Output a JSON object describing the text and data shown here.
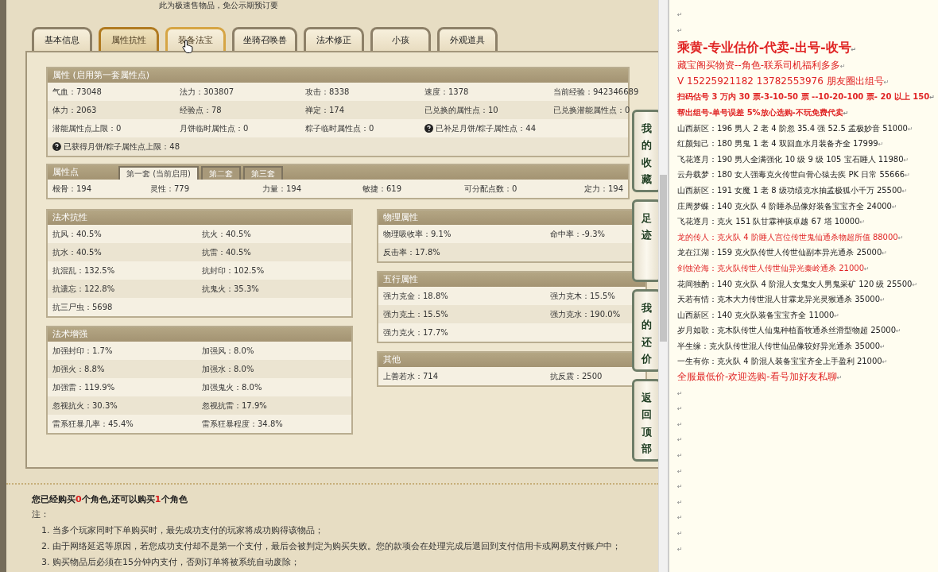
{
  "top_note": "此为极速售物品，免公示期预订要",
  "tabs": [
    {
      "label": "基本信息",
      "selected": false,
      "hovered": false
    },
    {
      "label": "属性抗性",
      "selected": true,
      "hovered": false
    },
    {
      "label": "装备法宝",
      "selected": false,
      "hovered": true
    },
    {
      "label": "坐骑召唤兽",
      "selected": false,
      "hovered": false
    },
    {
      "label": "法术修正",
      "selected": false,
      "hovered": false
    },
    {
      "label": "小孩",
      "selected": false,
      "hovered": false
    },
    {
      "label": "外观道具",
      "selected": false,
      "hovered": false
    }
  ],
  "attributes": {
    "title": "属性 (启用第一套属性点)",
    "rows": [
      [
        {
          "text": "气血：73048"
        },
        {
          "text": "法力：303807"
        },
        {
          "text": "攻击：8338"
        },
        {
          "text": "速度：1378"
        },
        {
          "text": "当前经验：942346689"
        }
      ],
      [
        {
          "text": "体力：2063"
        },
        {
          "text": "经验点：78"
        },
        {
          "text": "禅定：174"
        },
        {
          "text": "已兑换的属性点：10"
        },
        {
          "text": "已兑换潜能属性点：0"
        }
      ],
      [
        {
          "text": "潜能属性点上限：0"
        },
        {
          "text": "月饼临时属性点：0"
        },
        {
          "text": "粽子临时属性点：0"
        },
        {
          "text": "已补足月饼/粽子属性点：44",
          "help": true
        }
      ],
      [
        {
          "text": "已获得月饼/粽子属性点上限：48",
          "help": true
        }
      ]
    ]
  },
  "points": {
    "title": "属性点",
    "tabs": [
      {
        "label": "第一套 (当前启用)",
        "selected": true
      },
      {
        "label": "第二套",
        "selected": false
      },
      {
        "label": "第三套",
        "selected": false
      }
    ],
    "values": [
      "根骨：194",
      "灵性：779",
      "力量：194",
      "敏捷：619",
      "可分配点数：0",
      "定力：194"
    ]
  },
  "left_sections": [
    {
      "title": "法术抗性",
      "rows": [
        [
          "抗风：40.5%",
          "抗火：40.5%"
        ],
        [
          "抗水：40.5%",
          "抗雷：40.5%"
        ],
        [
          "抗混乱：132.5%",
          "抗封印：102.5%"
        ],
        [
          "抗遗忘：122.8%",
          "抗鬼火：35.3%"
        ],
        [
          "抗三尸虫：5698"
        ]
      ]
    },
    {
      "title": "法术增强",
      "rows": [
        [
          "加强封印：1.7%",
          "加强风：8.0%"
        ],
        [
          "加强火：8.8%",
          "加强水：8.0%"
        ],
        [
          "加强雷：119.9%",
          "加强鬼火：8.0%"
        ],
        [
          "忽视抗火：30.3%",
          "忽视抗雷：17.9%"
        ],
        [
          "雷系狂暴几率：45.4%",
          "雷系狂暴程度：34.8%"
        ]
      ]
    }
  ],
  "right_sections": [
    {
      "title": "物理属性",
      "rows": [
        [
          "物理吸收率：9.1%",
          "命中率：-9.3%"
        ],
        [
          "反击率：17.8%"
        ]
      ]
    },
    {
      "title": "五行属性",
      "rows": [
        [
          "强力克金：18.8%",
          "强力克木：15.5%"
        ],
        [
          "强力克土：15.5%",
          "强力克水：190.0%"
        ],
        [
          "强力克火：17.7%"
        ]
      ]
    },
    {
      "title": "其他",
      "rows": [
        [
          "上善若水：714",
          "抗反震：2500"
        ]
      ]
    }
  ],
  "side_buttons": [
    "我的收藏",
    "足迹",
    "我的还价",
    "返回顶部"
  ],
  "purchase": [
    {
      "text": "您已经购买",
      "highlight": false
    },
    {
      "text": "0",
      "highlight": true
    },
    {
      "text": "个角色,还可以购买",
      "highlight": false
    },
    {
      "text": "1",
      "highlight": true
    },
    {
      "text": "个角色",
      "highlight": false
    }
  ],
  "notes": {
    "title": "注：",
    "items": [
      "1. 当多个玩家同时下单购买时，最先成功支付的玩家将成功购得该物品；",
      "2. 由于网络延迟等原因，若您成功支付却不是第一个支付，最后会被判定为购买失败。您的款项会在处理完成后退回到支付信用卡或网易支付账户中；",
      "3. 购买物品后必须在15分钟内支付，否则订单将被系统自动废除；"
    ]
  },
  "doc": {
    "line_end": "↵",
    "lines": [
      {
        "kind": "blank"
      },
      {
        "kind": "blank"
      },
      {
        "kind": "title",
        "text": "乘黄-专业估价-代卖-出号-收号",
        "color": "#e02424"
      },
      {
        "kind": "large",
        "text": "藏宝阁买物资--角色-联系司机福利多多",
        "color": "#e02424"
      },
      {
        "kind": "large",
        "text": "V 15225921182    13782553976 朋友圈出组号",
        "color": "#e02424"
      },
      {
        "kind": "bold",
        "text": "扫码估号 3 万内 30 票-3-10-50 票  --10-20-100 票- 20 以上 150",
        "color": "#e02424"
      },
      {
        "kind": "bold",
        "text": "帮出组号-单号误差 5%放心选购-不玩免费代卖",
        "color": "#e02424"
      },
      {
        "kind": "normal",
        "text": "山西新区：196 男人 2 老 4 阶忽 35.4 强 52.5 孟极妙音 51000",
        "color": "#222222"
      },
      {
        "kind": "normal",
        "text": "红颜知己：180 男鬼 1 老 4 双回血水月装备齐全 17999",
        "color": "#222222"
      },
      {
        "kind": "normal",
        "text": "飞花逐月：190 男人全满强化 10 级 9 级 105 宝石睡人 11980",
        "color": "#222222"
      },
      {
        "kind": "normal",
        "text": "云舟载梦：180 女人强毒克火传世白骨心猿去疾 PK 日常 55666",
        "color": "#222222"
      },
      {
        "kind": "normal",
        "text": "山西新区：191 女魔 1 老 8 级功绩克水抽孟极狐小千万 25500",
        "color": "#222222"
      },
      {
        "kind": "normal",
        "text": "庄周梦蝶：140 克火队 4 阶睡杀品像好装备宝宝齐全 24000",
        "color": "#222222"
      },
      {
        "kind": "normal",
        "text": "飞花逐月：克火 151 队甘霖神孩卓越 67 塔 10000",
        "color": "#222222"
      },
      {
        "kind": "normal",
        "text": "龙的传人：克火队 4 阶睡人宫位传世鬼仙通杀物超所值 88000",
        "color": "#e02424"
      },
      {
        "kind": "normal",
        "text": "龙在江湖：159 克火队传世人传世仙副本异光通杀 25000",
        "color": "#222222"
      },
      {
        "kind": "normal",
        "text": "剑蚀沧海：克火队传世人传世仙异光秦岭通杀 21000",
        "color": "#e02424"
      },
      {
        "kind": "normal",
        "text": "花间独酌：140 克火队 4 阶混人女鬼女人男鬼采矿 120 级 25500",
        "color": "#222222"
      },
      {
        "kind": "normal",
        "text": "天若有情：克木大力传世混人甘霖龙异光灵猴通杀 35000",
        "color": "#222222"
      },
      {
        "kind": "normal",
        "text": "山西新区：140 克火队装备宝宝齐全 11000",
        "color": "#222222"
      },
      {
        "kind": "normal",
        "text": "岁月如歌：克木队传世人仙鬼种植畜牧通杀丝滑型物超 25000",
        "color": "#222222"
      },
      {
        "kind": "normal",
        "text": "半生缘：克火队传世混人传世仙品像较好异光通杀 35000",
        "color": "#222222"
      },
      {
        "kind": "normal",
        "text": "一生有你：克火队 4 阶混人装备宝宝齐全上手盈利 21000",
        "color": "#222222"
      },
      {
        "kind": "large",
        "text": "全服最低价-欢迎选购-看号加好友私聊",
        "color": "#e02424"
      },
      {
        "kind": "blank"
      },
      {
        "kind": "blank"
      },
      {
        "kind": "blank"
      },
      {
        "kind": "blank"
      },
      {
        "kind": "blank"
      },
      {
        "kind": "blank"
      },
      {
        "kind": "blank"
      },
      {
        "kind": "blank"
      },
      {
        "kind": "blank"
      },
      {
        "kind": "blank"
      },
      {
        "kind": "blank"
      }
    ]
  }
}
